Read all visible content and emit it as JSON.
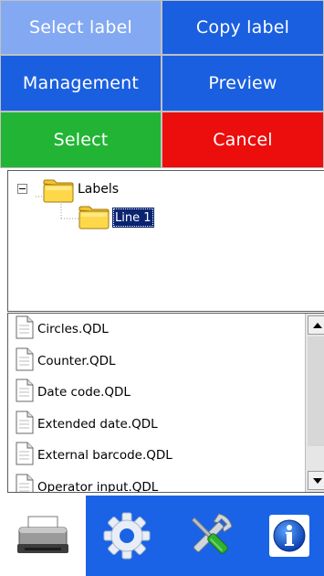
{
  "buttons": {
    "select_label": "Select label",
    "copy_label": "Copy label",
    "management": "Management",
    "preview": "Preview",
    "select": "Select",
    "cancel": "Cancel"
  },
  "colors": {
    "select_label_bg": "#83a9f2",
    "blue_bg": "#1a5fe0",
    "green_bg": "#22b535",
    "red_bg": "#ec0d0d"
  },
  "tree": {
    "root": {
      "label": "Labels",
      "icon": "folder-icon",
      "expander": "minus"
    },
    "child": {
      "label": "Line 1",
      "icon": "folder-icon",
      "selected": true
    }
  },
  "files": [
    {
      "name": "Circles.QDL",
      "icon": "document-icon"
    },
    {
      "name": "Counter.QDL",
      "icon": "document-icon"
    },
    {
      "name": "Date code.QDL",
      "icon": "document-icon"
    },
    {
      "name": "Extended date.QDL",
      "icon": "document-icon"
    },
    {
      "name": "External barcode.QDL",
      "icon": "document-icon"
    },
    {
      "name": "Operator input.QDL",
      "icon": "document-icon"
    }
  ],
  "toolbar": {
    "items": [
      "printer-icon",
      "gear-icon",
      "tools-icon",
      "info-icon"
    ],
    "active": "printer-icon"
  }
}
